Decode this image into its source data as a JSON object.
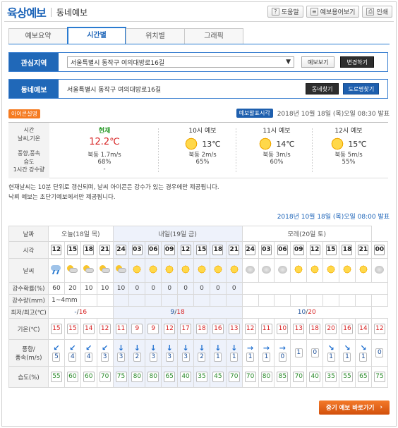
{
  "header": {
    "title": "육상예보",
    "subtitle": "동네예보"
  },
  "top_buttons": [
    {
      "icon": "help-icon",
      "glyph": "?",
      "label": "도움말"
    },
    {
      "icon": "glossary-icon",
      "glyph": "≡",
      "label": "예보용어보기"
    },
    {
      "icon": "print-icon",
      "glyph": "⎙",
      "label": "인쇄"
    }
  ],
  "tabs": [
    {
      "label": "예보요약",
      "active": false
    },
    {
      "label": "시간별",
      "active": true
    },
    {
      "label": "위치별",
      "active": false
    },
    {
      "label": "그래픽",
      "active": false
    }
  ],
  "interest": {
    "label": "관심지역",
    "value": "서울특별시 동작구 여의대방로16길",
    "view_btn": "예보보기",
    "change_btn": "변경하기"
  },
  "town": {
    "label": "동네예보",
    "address": "서울특별시 동작구 여의대방로16길",
    "find_btn": "동네찾기",
    "road_btn": "도로명찾기"
  },
  "icon_desc": "아이콘설명",
  "issue_label": "예보발표시각",
  "issue_time": "2018년 10월 18일 (목)오일 08:30 발표",
  "current": {
    "labels": [
      "시간",
      "날씨,기온",
      "풍향,풍속",
      "습도",
      "1시간 강수량"
    ],
    "now": {
      "header": "현재",
      "temp": "12.2℃",
      "wind": "북동 1.7m/s",
      "humidity": "68%",
      "rain": "-"
    },
    "forecasts": [
      {
        "header": "10시 예보",
        "temp": "13℃",
        "wind": "북동 2m/s",
        "humidity": "65%",
        "icon": "sun"
      },
      {
        "header": "11시 예보",
        "temp": "14℃",
        "wind": "북동 3m/s",
        "humidity": "60%",
        "icon": "sun"
      },
      {
        "header": "12시 예보",
        "temp": "15℃",
        "wind": "북동 5m/s",
        "humidity": "55%",
        "icon": "sun"
      }
    ]
  },
  "notes": [
    "현재날씨는 10분 단위로 갱신되며, 날씨 아이콘은 강수가 있는 경우에만 제공됩니다.",
    "낙뢰 예보는 초단기예보에서만 제공됩니다."
  ],
  "issue_time2": "2018년 10월 18일 (목)오일 08:00 발표",
  "grid": {
    "row_labels": [
      "날짜",
      "시각",
      "날씨",
      "강수확률(%)",
      "강수량(mm)",
      "최저/최고(℃)",
      "기온(℃)",
      "풍향/\n풍속(m/s)",
      "습도(%)"
    ],
    "days": [
      {
        "label": "오늘(18일 목)",
        "span": 4,
        "min": "-",
        "max": "16"
      },
      {
        "label": "내일(19일 금)",
        "span": 8,
        "min": "9",
        "max": "18"
      },
      {
        "label": "모레(20일 토)",
        "span": 8,
        "min": "10",
        "max": "20"
      }
    ],
    "hours": [
      "12",
      "15",
      "18",
      "21",
      "24",
      "03",
      "06",
      "09",
      "12",
      "15",
      "18",
      "21",
      "24",
      "03",
      "06",
      "09",
      "12",
      "15",
      "18",
      "21",
      "00"
    ],
    "weather": [
      "rain",
      "psun",
      "psun",
      "psun",
      "psun",
      "sun",
      "sun",
      "sun",
      "sun",
      "sun",
      "sun",
      "sun",
      "cld",
      "cld",
      "cld",
      "sun",
      "sun",
      "sun",
      "sun",
      "sun",
      "cld"
    ],
    "pop": [
      "60",
      "20",
      "10",
      "10",
      "10",
      "0",
      "0",
      "0",
      "0",
      "0",
      "0",
      "0",
      "",
      "",
      "",
      "",
      "",
      "",
      "",
      "",
      ""
    ],
    "rain_amt": "1~4mm",
    "temp": [
      "15",
      "15",
      "14",
      "12",
      "11",
      "9",
      "9",
      "12",
      "17",
      "18",
      "16",
      "13",
      "12",
      "11",
      "10",
      "13",
      "18",
      "20",
      "16",
      "14",
      "12"
    ],
    "wind_dir": [
      "↙",
      "↙",
      "↙",
      "↙",
      "↓",
      "↓",
      "↓",
      "↓",
      "↓",
      "↓",
      "↓",
      "↓",
      "→",
      "→",
      "→",
      "",
      "",
      "↘",
      "↘",
      "↘",
      ""
    ],
    "wind_spd": [
      "5",
      "4",
      "4",
      "3",
      "3",
      "2",
      "3",
      "3",
      "3",
      "2",
      "1",
      "1",
      "1",
      "1",
      "0",
      "1",
      "0",
      "1",
      "1",
      "1",
      "0"
    ],
    "humidity": [
      "55",
      "60",
      "60",
      "70",
      "75",
      "80",
      "80",
      "65",
      "40",
      "35",
      "45",
      "70",
      "70",
      "80",
      "85",
      "70",
      "40",
      "35",
      "55",
      "65",
      "75"
    ]
  },
  "mid_btn": "중기 예보 바로가기"
}
